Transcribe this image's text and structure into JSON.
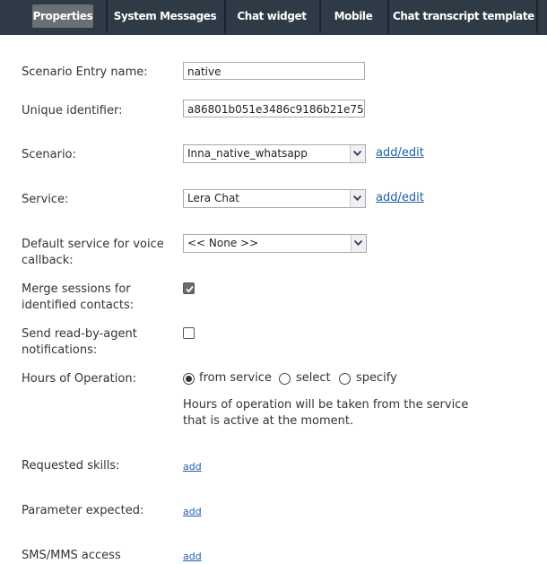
{
  "tabs": [
    {
      "label": "Properties",
      "active": true
    },
    {
      "label": "System Messages"
    },
    {
      "label": "Chat widget"
    },
    {
      "label": "Mobile"
    },
    {
      "label": "Chat transcript template"
    }
  ],
  "form": {
    "entry_name_label": "Scenario Entry name:",
    "entry_name_value": "native",
    "uid_label": "Unique identifier:",
    "uid_value": "a86801b051e3486c9186b21e75",
    "scenario_label": "Scenario:",
    "scenario_value": "Inna_native_whatsapp",
    "scenario_link": "add/edit",
    "service_label": "Service:",
    "service_value": "Lera Chat",
    "service_link": "add/edit",
    "default_service_label": "Default service for voice callback:",
    "default_service_value": "<< None >>",
    "merge_label": "Merge sessions for identified contacts:",
    "merge_checked": true,
    "send_read_label": "Send read-by-agent notifications:",
    "send_read_checked": false,
    "hours_label": "Hours of Operation:",
    "hours_options": [
      "from service",
      "select",
      "specify"
    ],
    "hours_selected": "from service",
    "hours_note": "Hours of operation will be taken from the service that is active at the moment.",
    "skills_label": "Requested skills:",
    "skills_link": "add",
    "param_label": "Parameter expected:",
    "param_link": "add",
    "sms_label": "SMS/MMS access",
    "sms_link": "add"
  },
  "colors": {
    "tabbar": "#2e3a46",
    "active_tab": "#6b7074",
    "link": "#1f5fa8"
  },
  "icons": {
    "dropdown": "chevron-down-icon",
    "check": "checkmark-icon"
  }
}
